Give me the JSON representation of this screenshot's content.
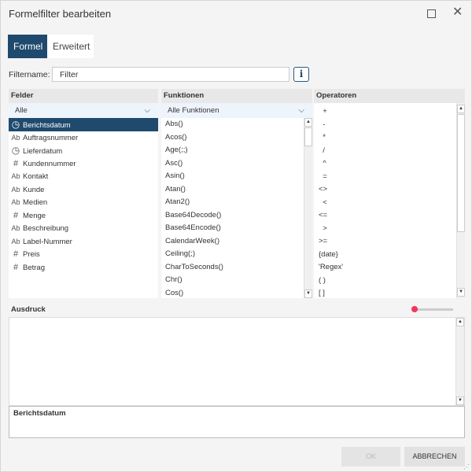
{
  "title": "Formelfilter bearbeiten",
  "tabs": [
    {
      "label": "Formel",
      "active": true
    },
    {
      "label": "Erweitert",
      "active": false
    }
  ],
  "filtername": {
    "label": "Filtername:",
    "value": "Filter",
    "info": "i"
  },
  "fields": {
    "header": "Felder",
    "dropdown": "Alle",
    "items": [
      {
        "icon": "clock",
        "label": "Berichtsdatum",
        "selected": true
      },
      {
        "icon": "text",
        "label": "Auftragsnummer"
      },
      {
        "icon": "clock",
        "label": "Lieferdatum"
      },
      {
        "icon": "number",
        "label": "Kundennummer"
      },
      {
        "icon": "text",
        "label": "Kontakt"
      },
      {
        "icon": "text",
        "label": "Kunde"
      },
      {
        "icon": "text",
        "label": "Medien"
      },
      {
        "icon": "number",
        "label": "Menge"
      },
      {
        "icon": "text",
        "label": "Beschreibung"
      },
      {
        "icon": "text",
        "label": "Label-Nummer"
      },
      {
        "icon": "number",
        "label": "Preis"
      },
      {
        "icon": "number",
        "label": "Betrag"
      }
    ]
  },
  "functions": {
    "header": "Funktionen",
    "dropdown": "Alle Funktionen",
    "items": [
      "Abs()",
      "Acos()",
      "Age(;;)",
      "Asc()",
      "Asin()",
      "Atan()",
      "Atan2()",
      "Base64Decode()",
      "Base64Encode()",
      "CalendarWeek()",
      "Ceiling(;)",
      "CharToSeconds()",
      "Chr()",
      "Cos()"
    ]
  },
  "operators": {
    "header": "Operatoren",
    "items": [
      "  +",
      "  -",
      "  *",
      "  /",
      "  ^",
      "  =",
      "<>",
      "  <",
      "<=",
      "  >",
      ">=",
      "{date}",
      "'Regex'",
      "( )",
      "[ ]"
    ]
  },
  "expression": {
    "header": "Ausdruck",
    "value": ""
  },
  "description": "Berichtsdatum",
  "buttons": {
    "ok": "OK",
    "cancel": "ABBRECHEN"
  },
  "colors": {
    "accent": "#1f4a6e",
    "slider": "#f0365a"
  }
}
